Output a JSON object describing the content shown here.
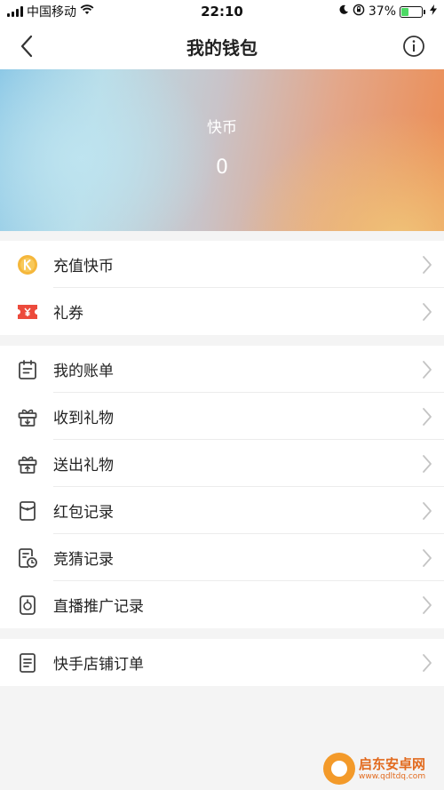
{
  "status_bar": {
    "carrier": "中国移动",
    "time": "22:10",
    "battery_percent": "37%",
    "battery_level": 0.37,
    "battery_color": "#4cd964",
    "icons": [
      "signal-icon",
      "wifi-icon",
      "moon-icon",
      "rotation-lock-icon",
      "battery-icon",
      "charging-icon"
    ]
  },
  "nav": {
    "title": "我的钱包",
    "back_icon": "chevron-left-icon",
    "info_icon": "info-icon"
  },
  "banner": {
    "label": "快币",
    "value": "0"
  },
  "sections": [
    {
      "items": [
        {
          "label": "充值快币",
          "icon": "kuaibi-coin-icon"
        },
        {
          "label": "礼券",
          "icon": "coupon-ticket-icon"
        }
      ]
    },
    {
      "items": [
        {
          "label": "我的账单",
          "icon": "calendar-bill-icon"
        },
        {
          "label": "收到礼物",
          "icon": "gift-received-icon"
        },
        {
          "label": "送出礼物",
          "icon": "gift-sent-icon"
        },
        {
          "label": "红包记录",
          "icon": "red-envelope-icon"
        },
        {
          "label": "竞猜记录",
          "icon": "quiz-record-icon"
        },
        {
          "label": "直播推广记录",
          "icon": "live-promo-icon"
        }
      ]
    },
    {
      "items": [
        {
          "label": "快手店铺订单",
          "icon": "shop-order-icon"
        }
      ]
    }
  ],
  "colors": {
    "accent_coin": "#f5b73b",
    "coupon_red": "#ec4a3c",
    "icon_gray": "#444444",
    "chevron_gray": "#c4c4c4"
  },
  "watermark": {
    "name": "启东安卓网",
    "url": "www.qdltdq.com"
  }
}
